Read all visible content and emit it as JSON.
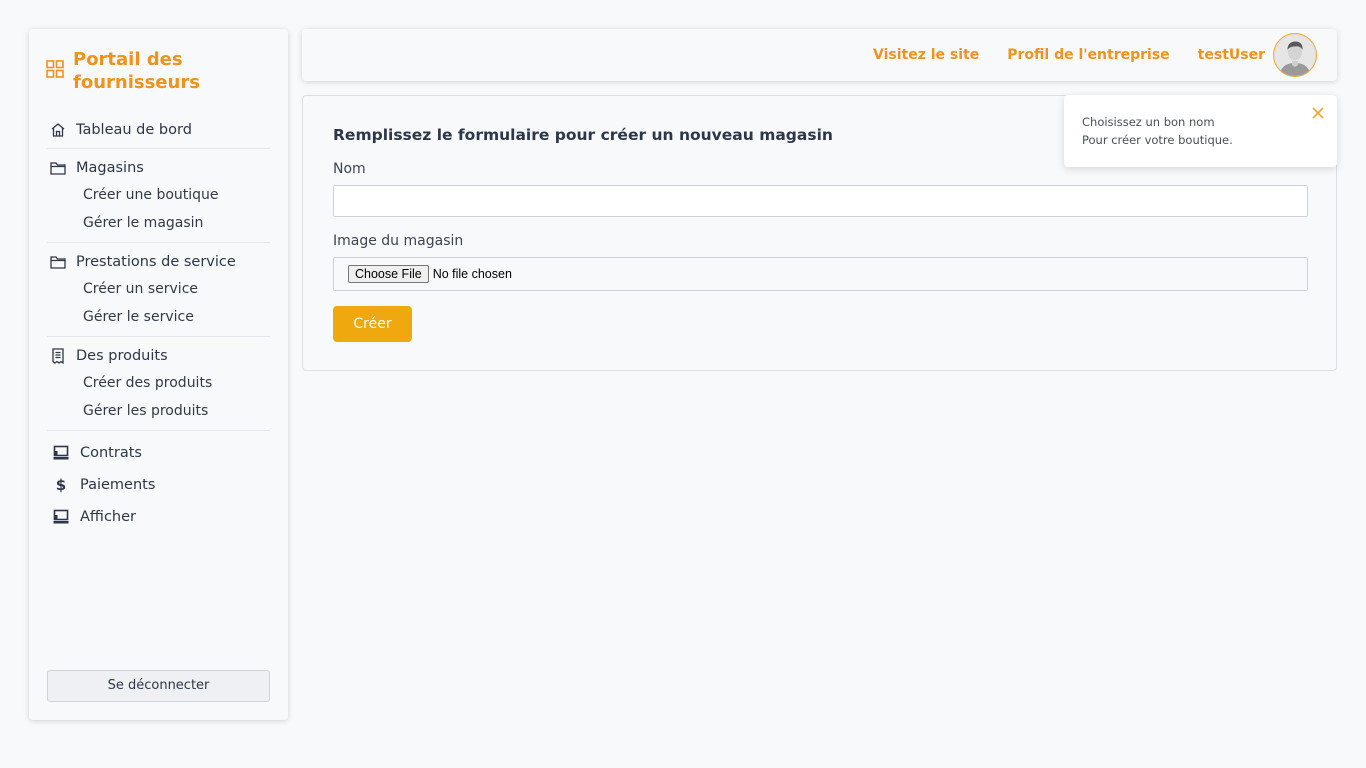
{
  "sidebar": {
    "brand": "Portail des fournisseurs",
    "groups": [
      {
        "label": "Tableau de bord",
        "icon": "home-icon",
        "items": []
      },
      {
        "label": "Magasins",
        "icon": "folder-icon",
        "items": [
          "Créer une boutique",
          "Gérer le magasin"
        ]
      },
      {
        "label": "Prestations de service",
        "icon": "folder-icon",
        "items": [
          "Créer un service",
          "Gérer le service"
        ]
      },
      {
        "label": "Des produits",
        "icon": "receipt-icon",
        "items": [
          "Créer des produits",
          "Gérer les produits"
        ]
      }
    ],
    "singles": [
      {
        "label": "Contrats",
        "icon": "monitor-icon"
      },
      {
        "label": "Paiements",
        "icon": "dollar-icon"
      },
      {
        "label": "Afficher",
        "icon": "monitor-icon"
      }
    ],
    "logout": "Se déconnecter"
  },
  "topbar": {
    "visit_site": "Visitez le site",
    "company_profile": "Profil de l'entreprise",
    "username": "testUser"
  },
  "form": {
    "title": "Remplissez le formulaire pour créer un nouveau magasin",
    "name_label": "Nom",
    "name_value": "",
    "image_label": "Image du magasin",
    "file_button": "Choose File",
    "file_status": "No file chosen",
    "submit": "Créer"
  },
  "toast": {
    "line1": "Choisissez un bon nom",
    "line2": "Pour créer votre boutique."
  },
  "colors": {
    "accent": "#f0921c",
    "button": "#f0a80f"
  }
}
